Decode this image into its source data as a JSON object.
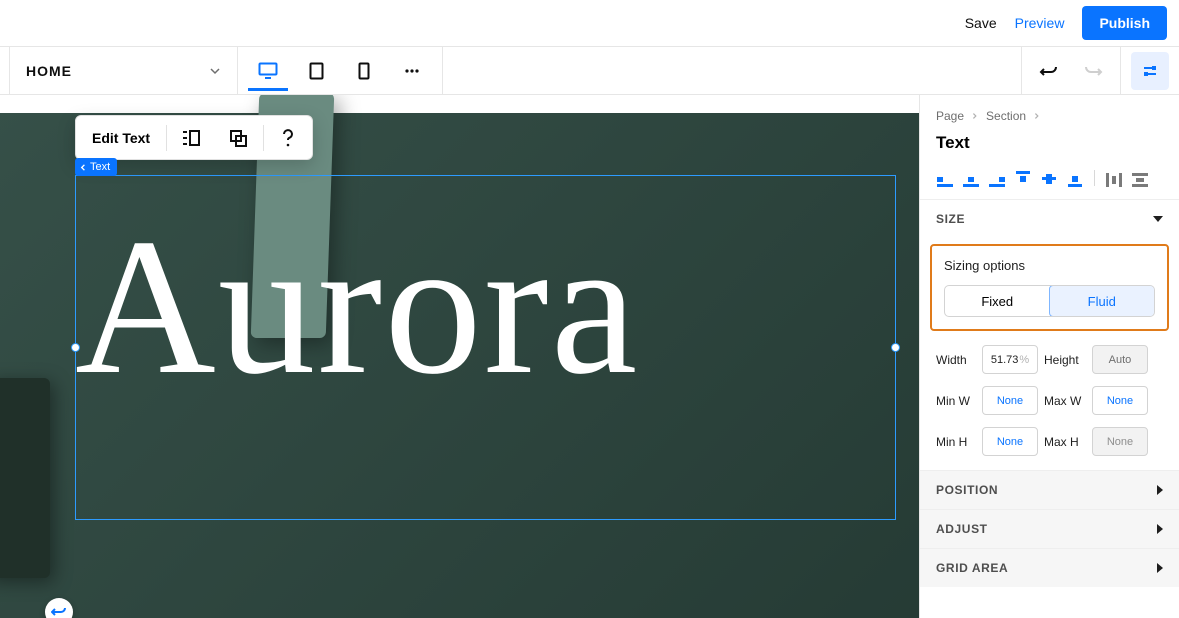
{
  "header": {
    "save": "Save",
    "preview": "Preview",
    "publish": "Publish"
  },
  "toolbar": {
    "page_name": "HOME"
  },
  "floating": {
    "edit_text": "Edit Text"
  },
  "selection": {
    "label": "Text"
  },
  "canvas": {
    "heading": "Aurora"
  },
  "panel": {
    "breadcrumb": [
      "Page",
      "Section"
    ],
    "title": "Text",
    "sections": {
      "size": "SIZE",
      "position": "POSITION",
      "adjust": "ADJUST",
      "grid_area": "GRID AREA"
    },
    "sizing": {
      "label": "Sizing options",
      "fixed": "Fixed",
      "fluid": "Fluid"
    },
    "dims": {
      "width_label": "Width",
      "width_value": "51.73",
      "width_unit": "%",
      "height_label": "Height",
      "height_value": "Auto",
      "minw_label": "Min W",
      "minw_value": "None",
      "maxw_label": "Max W",
      "maxw_value": "None",
      "minh_label": "Min H",
      "minh_value": "None",
      "maxh_label": "Max H",
      "maxh_value": "None"
    }
  }
}
